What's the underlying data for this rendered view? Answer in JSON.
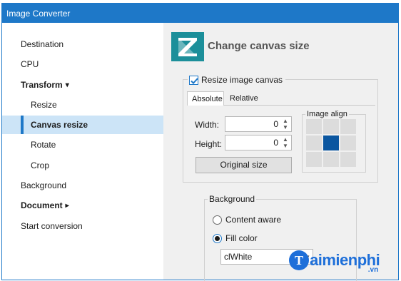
{
  "window": {
    "title": "Image Converter"
  },
  "sidebar": {
    "items": [
      {
        "label": "Destination"
      },
      {
        "label": "CPU"
      },
      {
        "label": "Transform",
        "expander": "▾"
      },
      {
        "label": "Resize"
      },
      {
        "label": "Canvas resize"
      },
      {
        "label": "Rotate"
      },
      {
        "label": "Crop"
      },
      {
        "label": "Background"
      },
      {
        "label": "Document",
        "expander": "▸"
      },
      {
        "label": "Start conversion"
      }
    ]
  },
  "content": {
    "heading": "Change canvas size",
    "resize_checkbox": {
      "label": "Resize image canvas",
      "checked": true
    },
    "tabs": [
      {
        "label": "Absolute"
      },
      {
        "label": "Relative"
      }
    ],
    "width": {
      "label": "Width:",
      "value": "0"
    },
    "height": {
      "label": "Height:",
      "value": "0"
    },
    "original_size_button": "Original size",
    "image_align": {
      "label": "Image align",
      "selected": "center"
    },
    "background": {
      "label": "Background",
      "options": [
        {
          "label": "Content aware",
          "selected": false
        },
        {
          "label": "Fill color",
          "selected": true
        }
      ],
      "color_value": "clWhite"
    }
  },
  "watermark": {
    "text": "aimienphi",
    "initial": "T",
    "suffix": ".vn"
  },
  "colors": {
    "accent": "#1e78c8",
    "selection": "#cce4f7",
    "logo": "#1c8f9a",
    "align_active": "#0a56a0"
  }
}
